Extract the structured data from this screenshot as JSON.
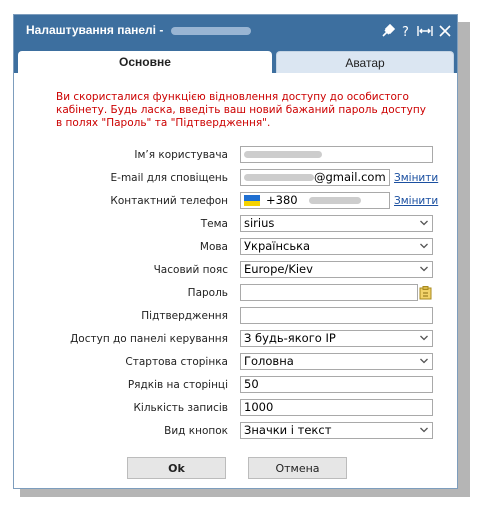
{
  "dialog": {
    "title": "Налаштування панелі -",
    "tabs": [
      {
        "label": "Основне",
        "active": true
      },
      {
        "label": "Аватар",
        "active": false
      }
    ]
  },
  "notice": "Ви скористалися функцією відновлення доступу до особистого кабінету. Будь ласка, введіть ваш новий бажаний пароль доступу в полях \"Пароль\" та \"Підтвердження\".",
  "form": {
    "username_label": "Ім’я користувача",
    "email_label": "E-mail для сповіщень",
    "email_suffix": "@gmail.com",
    "email_change": "Змінити",
    "phone_label": "Контактний телефон",
    "phone_prefix": "+380",
    "phone_change": "Змінити",
    "theme_label": "Тема",
    "theme_value": "sirius",
    "language_label": "Мова",
    "language_value": "Українська",
    "timezone_label": "Часовий пояс",
    "timezone_value": "Europe/Kiev",
    "password_label": "Пароль",
    "password_value": "",
    "confirm_label": "Підтвердження",
    "confirm_value": "",
    "access_label": "Доступ до панелі керування",
    "access_value": "З будь-якого IP",
    "startpage_label": "Стартова сторінка",
    "startpage_value": "Головна",
    "rows_label": "Рядків на сторінці",
    "rows_value": "50",
    "records_label": "Кількість записів",
    "records_value": "1000",
    "buttons_view_label": "Вид кнопок",
    "buttons_view_value": "Значки і текст"
  },
  "buttons": {
    "ok": "Ok",
    "cancel": "Отмена"
  },
  "colors": {
    "titlebar": "#3d6f9f",
    "notice": "#cc0000",
    "link": "#1a4fa0"
  }
}
